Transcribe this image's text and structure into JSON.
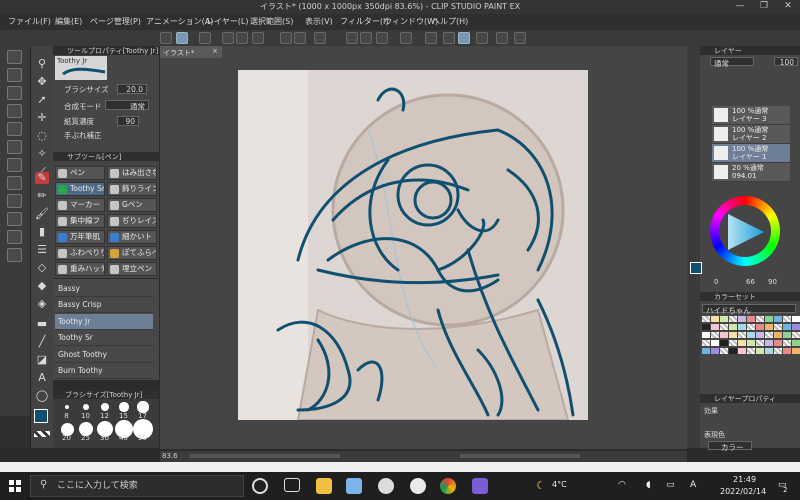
{
  "title": "イラスト* (1000 x 1000px 350dpi 83.6%) - CLIP STUDIO PAINT EX",
  "window_buttons": [
    "—",
    "❐",
    "✕"
  ],
  "menu": [
    "ファイル(F)",
    "編集(E)",
    "ページ管理(P)",
    "アニメーション(A)",
    "レイヤー(L)",
    "選択範囲(S)",
    "表示(V)",
    "フィルター(I)",
    "ウィンドウ(W)",
    "ヘルプ(H)"
  ],
  "tab": {
    "label": "イラスト*",
    "close": "×"
  },
  "tool_property": {
    "header": "ツールプロパティ[Toothy Jr]",
    "preset_name": "Toothy Jr",
    "rows": [
      {
        "label": "ブラシサイズ",
        "value": "20.0"
      },
      {
        "label": "合成モード",
        "value": "通常"
      },
      {
        "label": "紙質濃度",
        "value": "90"
      },
      {
        "label": "手ぶれ補正",
        "value": ""
      }
    ]
  },
  "sub_tool": {
    "header": "サブツール[ペン]",
    "items": [
      {
        "label": "ペン",
        "color": "#c5c5c5"
      },
      {
        "label": "はみ出さない",
        "color": "#c5c5c5"
      },
      {
        "label": "Toothy Sr",
        "color": "#2aa84a"
      },
      {
        "label": "飾りライン",
        "color": "#c5c5c5"
      },
      {
        "label": "マーカー",
        "color": "#c5c5c5"
      },
      {
        "label": "Gペン",
        "color": "#c5c5c5"
      },
      {
        "label": "集中線フ",
        "color": "#c5c5c5"
      },
      {
        "label": "ぢりレイズ",
        "color": "#c5c5c5"
      },
      {
        "label": "万年筆肌",
        "color": "#3d7dd0"
      },
      {
        "label": "細かいト",
        "color": "#3d7dd0"
      },
      {
        "label": "ふわぺりり",
        "color": "#c5c5c5"
      },
      {
        "label": "ぽてふらべ",
        "color": "#d4a23a"
      },
      {
        "label": "重みハッチ",
        "color": "#c5c5c5"
      },
      {
        "label": "埋立ペン",
        "color": "#c5c5c5"
      }
    ]
  },
  "brushes": [
    "Bassy",
    "Bassy Crisp",
    "Toothy Jr",
    "Toothy Sr",
    "Ghost Toothy",
    "Burn Toothy"
  ],
  "brush_size": {
    "header": "ブラシサイズ[Toothy Jr]",
    "sizes": [
      "8",
      "10",
      "12",
      "15",
      "17",
      "20",
      "25",
      "30",
      "40",
      "50"
    ]
  },
  "zoom_value": "83.6",
  "layers": {
    "header": "レイヤー",
    "blend": "通常",
    "opacity": "100",
    "items": [
      {
        "pct": "100 %通常",
        "name": "レイヤー 3"
      },
      {
        "pct": "100 %通常",
        "name": "レイヤー 2"
      },
      {
        "pct": "100 %通常",
        "name": "レイヤー 1"
      },
      {
        "pct": "20 %通常",
        "name": "094.01"
      }
    ]
  },
  "color": {
    "h": "0",
    "s": "66",
    "v": "90",
    "main": "#0f5071"
  },
  "color_set": {
    "header": "カラーセット",
    "name": "ハイドちゃん"
  },
  "layer_property": {
    "header": "レイヤープロパティ",
    "effect_label": "効果",
    "display_color_label": "表現色",
    "display_color_value": "カラー"
  },
  "taskbar": {
    "search_placeholder": "ここに入力して検索",
    "weather": "4°C",
    "time": "21:49",
    "date": "2022/02/14",
    "ime": "A",
    "notifications": "2"
  },
  "colors": {
    "stroke": "#0f5071",
    "accent": "#c43c3c"
  }
}
